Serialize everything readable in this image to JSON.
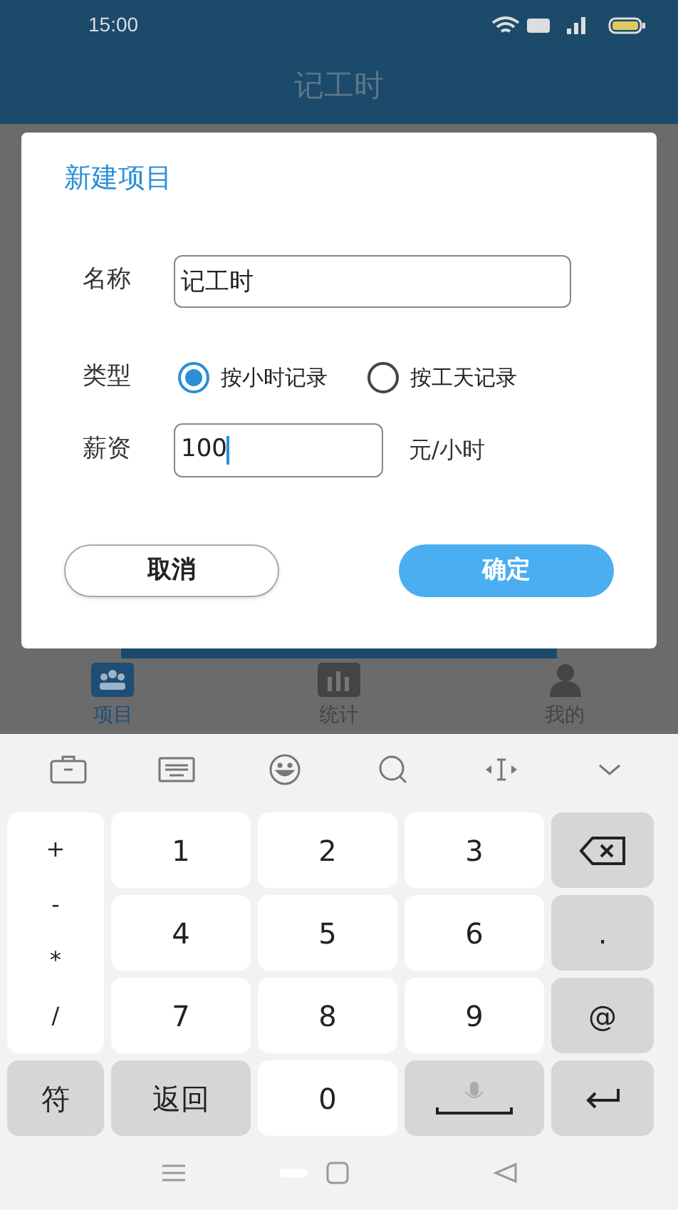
{
  "status_bar": {
    "time": "15:00"
  },
  "header": {
    "title": "记工时"
  },
  "dialog": {
    "title": "新建项目",
    "name_field": {
      "label": "名称",
      "value": "记工时"
    },
    "type_field": {
      "label": "类型",
      "options": [
        {
          "label": "按小时记录",
          "selected": true
        },
        {
          "label": "按工天记录",
          "selected": false
        }
      ]
    },
    "wage_field": {
      "label": "薪资",
      "value": "100",
      "unit": "元/小时"
    },
    "buttons": [
      {
        "label": "取消",
        "kind": "secondary"
      },
      {
        "label": "确定",
        "kind": "primary"
      }
    ]
  },
  "tab_bar": [
    {
      "label": "项目",
      "selected": true
    },
    {
      "label": "统计",
      "selected": false
    },
    {
      "label": "我的",
      "selected": false
    }
  ],
  "keyboard": {
    "symbols": [
      "+",
      "-",
      "*",
      "/"
    ],
    "keys": [
      {
        "kind": "digit",
        "label": "1"
      },
      {
        "kind": "digit",
        "label": "2"
      },
      {
        "kind": "digit",
        "label": "3"
      },
      {
        "kind": "backspace"
      },
      {
        "kind": "digit",
        "label": "4"
      },
      {
        "kind": "digit",
        "label": "5"
      },
      {
        "kind": "digit",
        "label": "6"
      },
      {
        "kind": "function",
        "label": "."
      },
      {
        "kind": "digit",
        "label": "7"
      },
      {
        "kind": "digit",
        "label": "8"
      },
      {
        "kind": "digit",
        "label": "9"
      },
      {
        "kind": "function",
        "label": "@"
      },
      {
        "kind": "function",
        "label": "符"
      },
      {
        "kind": "function",
        "label": "返回"
      },
      {
        "kind": "digit",
        "label": "0"
      },
      {
        "kind": "space"
      },
      {
        "kind": "enter"
      }
    ]
  }
}
